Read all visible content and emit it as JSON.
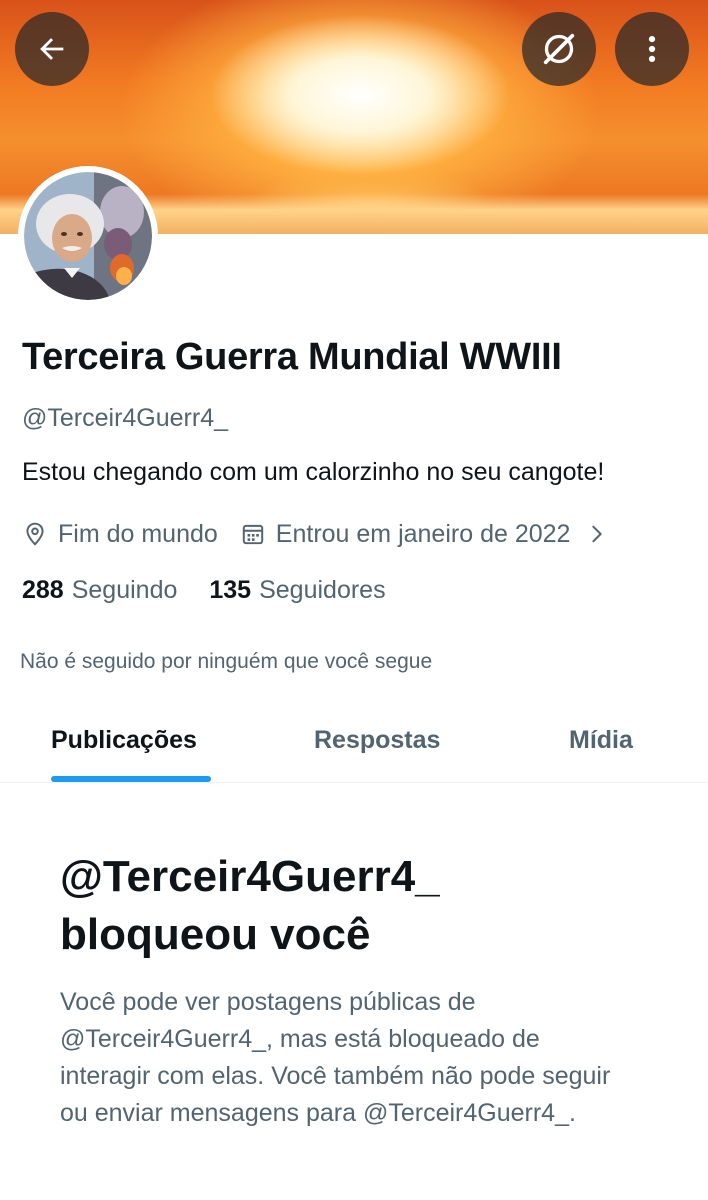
{
  "header": {
    "back_icon": "arrow-left-icon",
    "grok_icon": "grok-slash-icon",
    "more_icon": "more-vertical-icon"
  },
  "profile": {
    "name": "Terceira Guerra Mundial WWIII",
    "handle": "@Terceir4Guerr4_",
    "bio": "Estou chegando com um calorzinho no seu cangote!",
    "location": "Fim do mundo",
    "joined": "Entrou em janeiro de 2022",
    "following_count": "288",
    "following_label": "Seguindo",
    "followers_count": "135",
    "followers_label": "Seguidores",
    "not_followed": "Não é seguido por ninguém que você segue"
  },
  "tabs": [
    {
      "label": "Publicações",
      "active": true
    },
    {
      "label": "Respostas",
      "active": false
    },
    {
      "label": "Mídia",
      "active": false
    }
  ],
  "blocked": {
    "title_line1": "@Terceir4Guerr4_",
    "title_line2": "bloqueou você",
    "body": "Você pode ver postagens públicas de @Terceir4Guerr4_, mas está bloqueado de interagir com elas. Você também não pode seguir ou enviar mensagens para @Terceir4Guerr4_."
  },
  "colors": {
    "accent": "#1d9bf0",
    "text_primary": "#0f1419",
    "text_secondary": "#536471"
  }
}
